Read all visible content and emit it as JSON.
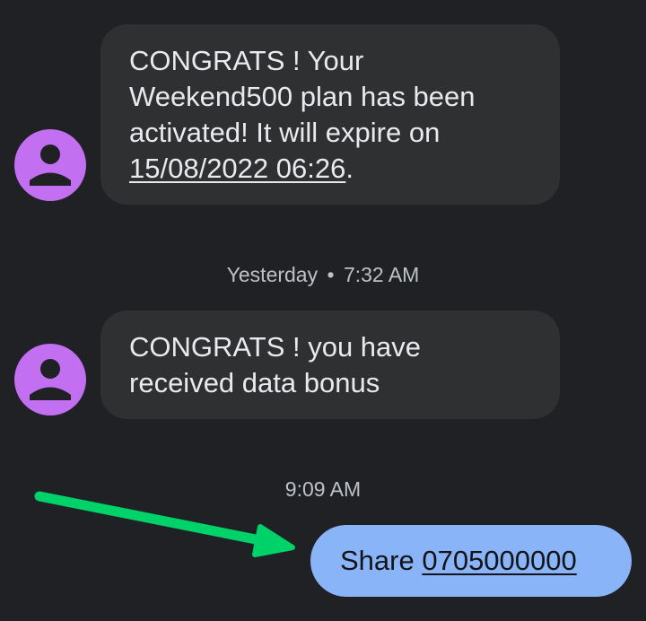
{
  "colors": {
    "background": "#202124",
    "incoming_bubble": "#2f3032",
    "outgoing_bubble": "#8ab4f8",
    "avatar": "#c26ff1",
    "arrow": "#00d26a"
  },
  "conversation": {
    "messages": [
      {
        "sender_icon": "person-icon",
        "text": "CONGRATS ! Your Weekend500 plan has been activated! It will expire on ",
        "link": "15/08/2022 06:26",
        "suffix": "."
      },
      {
        "sender_icon": "person-icon",
        "text": "CONGRATS ! you have received data bonus"
      }
    ],
    "timestamps": [
      {
        "day": "Yesterday",
        "separator": "•",
        "time": "7:32 AM"
      },
      {
        "time": "9:09 AM"
      }
    ],
    "outgoing": {
      "prefix": "Share ",
      "link": "0705000000"
    }
  },
  "annotation": {
    "icon": "green-arrow-icon"
  }
}
